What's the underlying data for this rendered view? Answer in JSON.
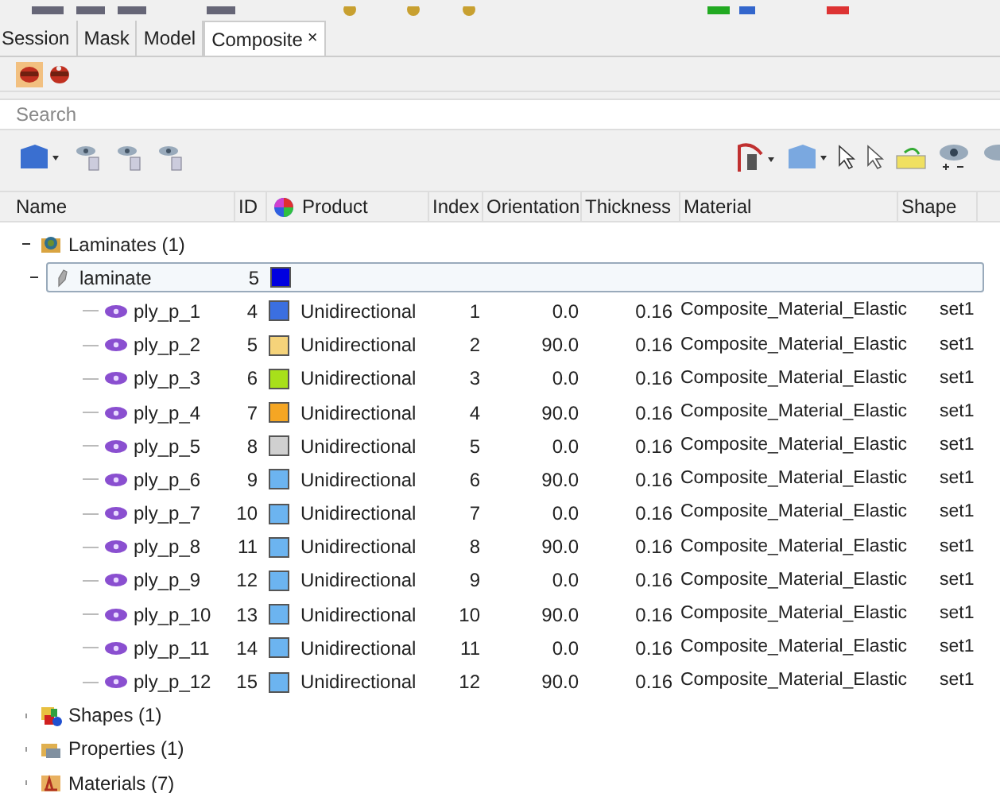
{
  "tabs": [
    {
      "label": "Session",
      "selected": false
    },
    {
      "label": "Mask",
      "selected": false
    },
    {
      "label": "Model",
      "selected": false
    },
    {
      "label": "Composite",
      "selected": true,
      "close": "×"
    }
  ],
  "search": {
    "placeholder": "Search"
  },
  "table": {
    "columns": [
      "Name",
      "ID",
      "Product",
      "Index",
      "Orientation",
      "Thickness",
      "Material",
      "Shape"
    ],
    "tree": [
      {
        "kind": "folder",
        "name": "Laminates (1)",
        "expanded": true,
        "children": [
          {
            "kind": "laminate",
            "name": "laminate",
            "id": "5",
            "color": "#0000e0",
            "selected": true,
            "expanded": true,
            "children": [
              {
                "kind": "ply",
                "name": "ply_p_1",
                "id": "4",
                "color": "#3b6fe0",
                "product": "Unidirectional",
                "index": "1",
                "orientation": "0.0",
                "thickness": "0.16",
                "material": "Composite_Material_Elastic",
                "shape": "set1"
              },
              {
                "kind": "ply",
                "name": "ply_p_2",
                "id": "5",
                "color": "#f5d37a",
                "product": "Unidirectional",
                "index": "2",
                "orientation": "90.0",
                "thickness": "0.16",
                "material": "Composite_Material_Elastic",
                "shape": "set1"
              },
              {
                "kind": "ply",
                "name": "ply_p_3",
                "id": "6",
                "color": "#a8e01a",
                "product": "Unidirectional",
                "index": "3",
                "orientation": "0.0",
                "thickness": "0.16",
                "material": "Composite_Material_Elastic",
                "shape": "set1"
              },
              {
                "kind": "ply",
                "name": "ply_p_4",
                "id": "7",
                "color": "#f5a623",
                "product": "Unidirectional",
                "index": "4",
                "orientation": "90.0",
                "thickness": "0.16",
                "material": "Composite_Material_Elastic",
                "shape": "set1"
              },
              {
                "kind": "ply",
                "name": "ply_p_5",
                "id": "8",
                "color": "#d0d0d0",
                "product": "Unidirectional",
                "index": "5",
                "orientation": "0.0",
                "thickness": "0.16",
                "material": "Composite_Material_Elastic",
                "shape": "set1"
              },
              {
                "kind": "ply",
                "name": "ply_p_6",
                "id": "9",
                "color": "#6cb4f0",
                "product": "Unidirectional",
                "index": "6",
                "orientation": "90.0",
                "thickness": "0.16",
                "material": "Composite_Material_Elastic",
                "shape": "set1"
              },
              {
                "kind": "ply",
                "name": "ply_p_7",
                "id": "10",
                "color": "#6cb4f0",
                "product": "Unidirectional",
                "index": "7",
                "orientation": "0.0",
                "thickness": "0.16",
                "material": "Composite_Material_Elastic",
                "shape": "set1"
              },
              {
                "kind": "ply",
                "name": "ply_p_8",
                "id": "11",
                "color": "#6cb4f0",
                "product": "Unidirectional",
                "index": "8",
                "orientation": "90.0",
                "thickness": "0.16",
                "material": "Composite_Material_Elastic",
                "shape": "set1"
              },
              {
                "kind": "ply",
                "name": "ply_p_9",
                "id": "12",
                "color": "#6cb4f0",
                "product": "Unidirectional",
                "index": "9",
                "orientation": "0.0",
                "thickness": "0.16",
                "material": "Composite_Material_Elastic",
                "shape": "set1"
              },
              {
                "kind": "ply",
                "name": "ply_p_10",
                "id": "13",
                "color": "#6cb4f0",
                "product": "Unidirectional",
                "index": "10",
                "orientation": "90.0",
                "thickness": "0.16",
                "material": "Composite_Material_Elastic",
                "shape": "set1"
              },
              {
                "kind": "ply",
                "name": "ply_p_11",
                "id": "14",
                "color": "#6cb4f0",
                "product": "Unidirectional",
                "index": "11",
                "orientation": "0.0",
                "thickness": "0.16",
                "material": "Composite_Material_Elastic",
                "shape": "set1"
              },
              {
                "kind": "ply",
                "name": "ply_p_12",
                "id": "15",
                "color": "#6cb4f0",
                "product": "Unidirectional",
                "index": "12",
                "orientation": "90.0",
                "thickness": "0.16",
                "material": "Composite_Material_Elastic",
                "shape": "set1"
              }
            ]
          }
        ]
      },
      {
        "kind": "folder",
        "name": "Shapes (1)",
        "expanded": false
      },
      {
        "kind": "folder",
        "name": "Properties (1)",
        "expanded": false
      },
      {
        "kind": "folder",
        "name": "Materials (7)",
        "expanded": false
      }
    ]
  }
}
